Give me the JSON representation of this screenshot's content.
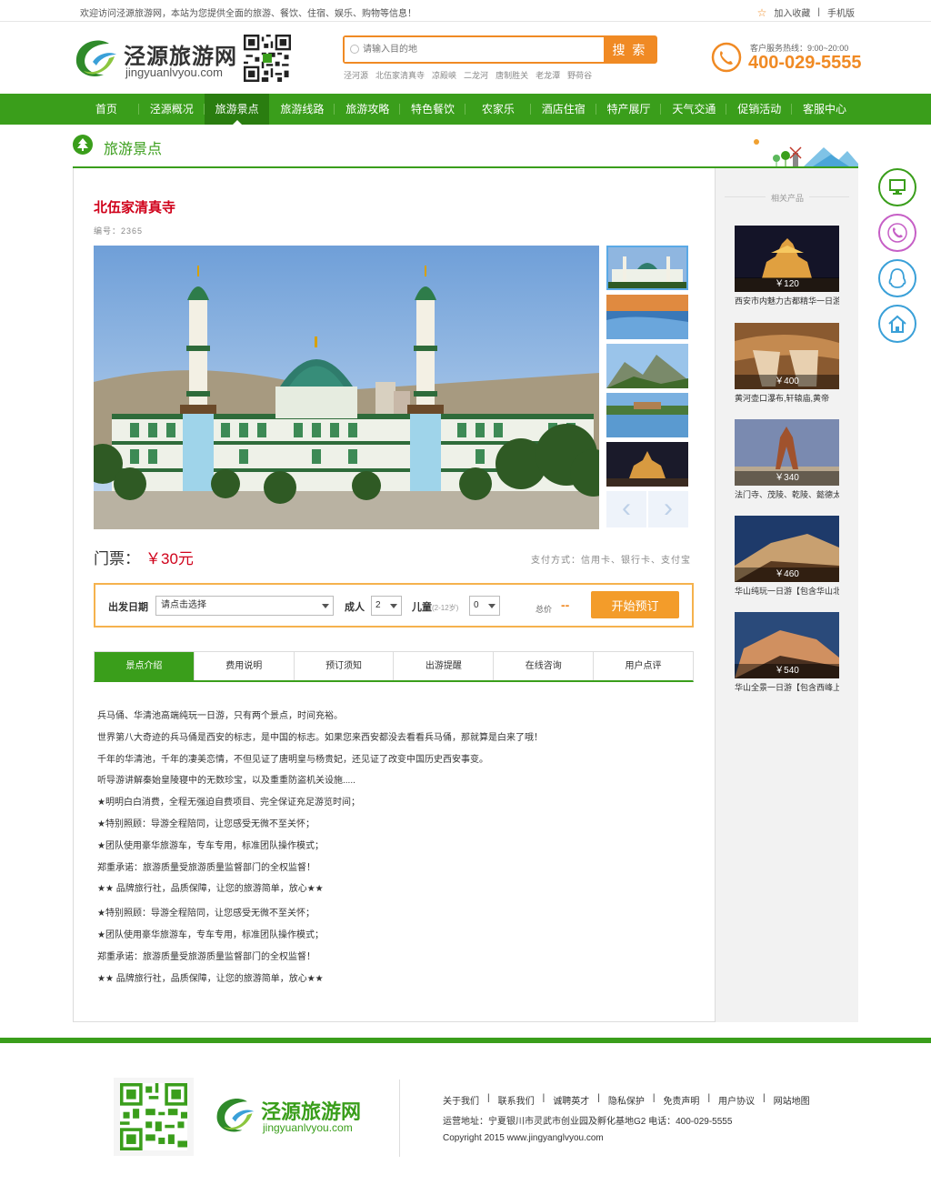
{
  "topbar": {
    "welcome": "欢迎访问泾源旅游网，本站为您提供全面的旅游、餐饮、住宿、娱乐、购物等信息！",
    "favorite": "加入收藏",
    "mobile": "手机版"
  },
  "logo": {
    "cn": "泾源旅游网",
    "en": "jingyuanlvyou.com"
  },
  "search": {
    "placeholder": "请输入目的地",
    "button": "搜 索",
    "hot": [
      "泾河源",
      "北伍家清真寺",
      "凉殿峡",
      "二龙河",
      "唐制胜关",
      "老龙潭",
      "野荷谷"
    ]
  },
  "hotline": {
    "label": "客户服务热线：9:00~20:00",
    "number": "400-029-5555"
  },
  "nav": [
    "首页",
    "泾源概况",
    "旅游景点",
    "旅游线路",
    "旅游攻略",
    "特色餐饮",
    "农家乐",
    "酒店住宿",
    "特产展厅",
    "天气交通",
    "促销活动",
    "客服中心"
  ],
  "section": {
    "title": "旅游景点"
  },
  "detail": {
    "title": "北伍家清真寺",
    "code": "编号：2365",
    "ticket_label": "门票：",
    "ticket_price": "￥30元",
    "payment": "支付方式：信用卡、银行卡、支付宝"
  },
  "booking": {
    "date_label": "出发日期",
    "date_value": "请点击选择",
    "adult_label": "成人",
    "adult_value": "2",
    "child_label": "儿童",
    "child_note": "(2-12岁)",
    "child_value": "0",
    "total_label": "总价",
    "total_value": "--",
    "button": "开始预订"
  },
  "tabs": [
    "景点介绍",
    "费用说明",
    "预订须知",
    "出游提醒",
    "在线咨询",
    "用户点评"
  ],
  "content": [
    "兵马俑、华清池高端纯玩一日游，只有两个景点，时间充裕。",
    "世界第八大奇迹的兵马俑是西安的标志，是中国的标志。如果您来西安都没去看看兵马俑，那就算是白来了哦！",
    "千年的华清池，千年的凄美恋情，不但见证了唐明皇与杨贵妃，还见证了改变中国历史西安事变。",
    "听导游讲解秦始皇陵寝中的无数珍宝，以及重重防盗机关设施.....",
    "★明明白白消费，全程无强迫自费项目、完全保证充足游览时间；",
    "★特别照顾：导游全程陪同，让您感受无微不至关怀；",
    "★团队使用豪华旅游车，专车专用，标准团队操作模式；",
    "郑重承诺：旅游质量受旅游质量监督部门的全权监督！",
    "★★ 品牌旅行社，品质保障，让您的旅游简单，放心★★",
    "★特别照顾：导游全程陪同，让您感受无微不至关怀；",
    "★团队使用豪华旅游车，专车专用，标准团队操作模式；",
    "郑重承诺：旅游质量受旅游质量监督部门的全权监督！",
    "★★ 品牌旅行社，品质保障，让您的旅游简单，放心★★"
  ],
  "related": {
    "label": "相关产品",
    "items": [
      {
        "price": "￥120",
        "name": "西安市内魅力古都精华一日游"
      },
      {
        "price": "￥400",
        "name": "黄河壶口瀑布,轩辕庙,黄帝"
      },
      {
        "price": "￥340",
        "name": "法门寺、茂陵、乾陵、懿德太"
      },
      {
        "price": "￥460",
        "name": "华山纯玩一日游【包含华山北"
      },
      {
        "price": "￥540",
        "name": "华山全景一日游【包含西峰上"
      }
    ]
  },
  "footer": {
    "logo_cn": "泾源旅游网",
    "logo_en": "jingyuanlvyou.com",
    "links": [
      "关于我们",
      "|",
      "联系我们",
      "|",
      "诚聘英才",
      "|",
      "隐私保护",
      "|",
      "免责声明",
      "|",
      "用户协议",
      "|",
      "网站地图"
    ],
    "address": "运营地址：宁夏银川市灵武市创业园及孵化基地G2   电话：400-029-5555",
    "copyright": "Copyright 2015 www.jingyanglvyou.com"
  },
  "colors": {
    "brand_green": "#3a9e1b",
    "accent_orange": "#f08a24",
    "price_red": "#d0021b"
  }
}
